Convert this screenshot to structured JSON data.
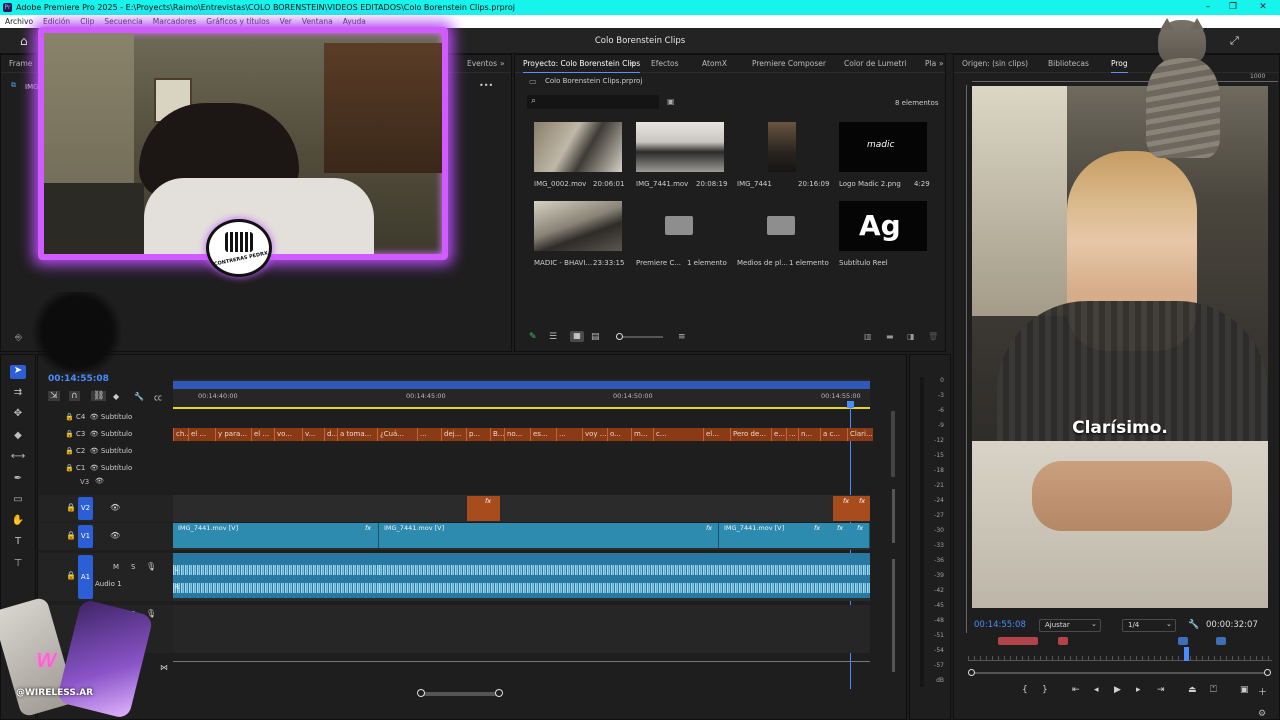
{
  "window": {
    "title": "Adobe Premiere Pro 2025 - E:\\Proyects\\Raimo\\Entrevistas\\COLO BORENSTEIN\\VIDEOS EDITADOS\\Colo Borenstein Clips.prproj",
    "app_icon": "Pr",
    "controls": {
      "minimize": "–",
      "maximize": "❐",
      "close": "✕"
    }
  },
  "menu": [
    "Archivo",
    "Edición",
    "Clip",
    "Secuencia",
    "Marcadores",
    "Gráficos y títulos",
    "Ver",
    "Ventana",
    "Ayuda"
  ],
  "header": {
    "project_title": "Colo Borenstein Clips"
  },
  "left_panel": {
    "tab_partial": "Frame",
    "item_partial": "IMG",
    "tab_eventos": "Eventos",
    "more": "»",
    "menu": "•••"
  },
  "project_panel": {
    "tabs": [
      "Proyecto: Colo Borenstein Clips",
      "Efectos",
      "AtomX",
      "Premiere Composer",
      "Color de Lumetri",
      "Pla"
    ],
    "more": "»",
    "file_name": "Colo Borenstein Clips.prproj",
    "search_placeholder": "",
    "count": "8 elementos",
    "items": [
      {
        "name": "IMG_0002.mov",
        "meta": "20:06:01"
      },
      {
        "name": "IMG_7441.mov",
        "meta": "20:08:19"
      },
      {
        "name": "IMG_7441",
        "meta": "20:16:09"
      },
      {
        "name": "Logo Madic 2.png",
        "meta": "4:29"
      },
      {
        "name": "MADIC - BHAVI...",
        "meta": "23:33:15"
      },
      {
        "name": "Premiere C...",
        "meta": "1 elemento"
      },
      {
        "name": "Medios de pl...",
        "meta": "1 elemento"
      },
      {
        "name": "Subtítulo Reel",
        "meta": ""
      }
    ],
    "logo_text": "madic",
    "graphic_text": "Ag"
  },
  "program_panel": {
    "tabs": [
      "Origen: (sin clips)",
      "Bibliotecas",
      "Prog"
    ],
    "ruler_ticks": [
      "800",
      "1000"
    ],
    "subtitle": "Clarísimo.",
    "timecode": "00:14:55:08",
    "fit": "Ajustar",
    "res": "1/4",
    "duration": "00:00:32:07"
  },
  "timeline": {
    "timecode": "00:14:55:08",
    "ruler": [
      "00:14:40:00",
      "00:14:45:00",
      "00:14:50:00",
      "00:14:55:00"
    ],
    "subtitle_tracks": [
      {
        "id": "C4",
        "name": "Subtítulo"
      },
      {
        "id": "C3",
        "name": "Subtítulo"
      },
      {
        "id": "C2",
        "name": "Subtítulo"
      },
      {
        "id": "C1",
        "name": "Subtítulo"
      }
    ],
    "captions": [
      "ch...",
      "el ...",
      "y para...",
      "el ...",
      "vo...",
      "v...",
      "d...",
      "a toma...",
      "¿Cuá...",
      "...",
      "dej...",
      "p...",
      "B...",
      "no...",
      "es...",
      "...",
      "voy ...",
      "o...",
      "m...",
      "c...",
      "el...",
      "Pero de...",
      "e...",
      "...",
      "n...",
      "a c...",
      "Clari..."
    ],
    "v3": "V3",
    "v2": "V2",
    "v1": "V1",
    "a1": "A1",
    "audio_name": "Audio 1",
    "m": "M",
    "s": "S",
    "fx": "fx",
    "clips": [
      "IMG_7441.mov [V]",
      "IMG_7441.mov [V]",
      "IMG_7441.mov [V]"
    ],
    "waveform_l": "L",
    "waveform_r": "R"
  },
  "meter": [
    "0",
    "-3",
    "-6",
    "-9",
    "-12",
    "-15",
    "-18",
    "-21",
    "-24",
    "-27",
    "-30",
    "-33",
    "-36",
    "-39",
    "-42",
    "-45",
    "-48",
    "-51",
    "-54",
    "-57",
    "dB"
  ],
  "overlay": {
    "badge_text": "CONTRERAS PEDRX",
    "watermark": "@WIRELESS.AR"
  }
}
